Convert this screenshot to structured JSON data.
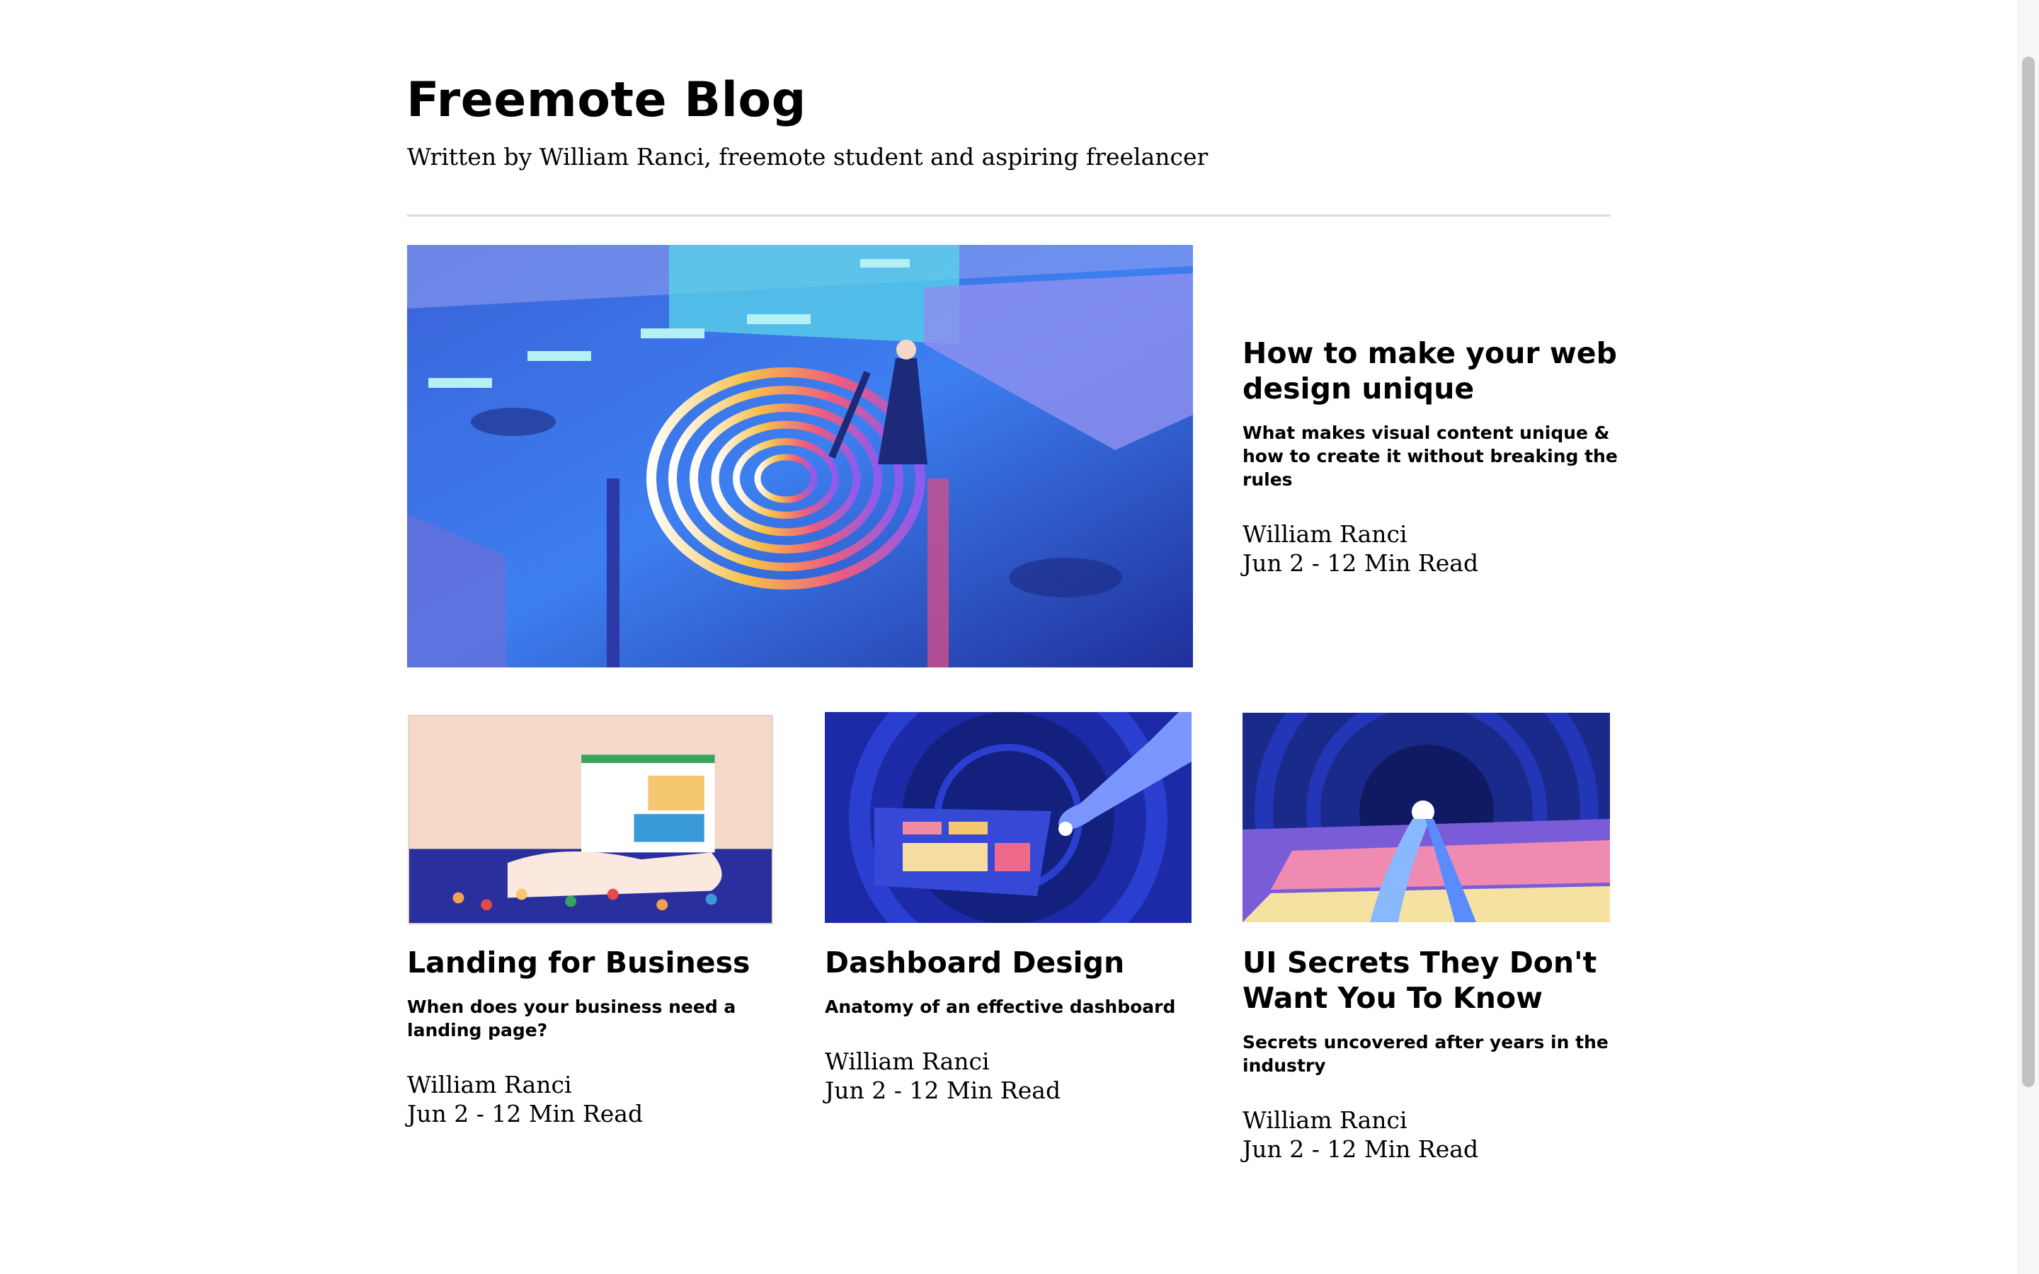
{
  "header": {
    "title": "Freemote Blog",
    "subtitle": "Written by William Ranci, freemote student and aspiring freelancer"
  },
  "featured": {
    "title_line1": "How to make your web",
    "title_line2": "design unique",
    "desc_line1": "What makes visual content unique &",
    "desc_line2": "how to create it without breaking the",
    "desc_line3": "rules",
    "author": "William Ranci",
    "meta": "Jun 2 - 12 Min Read"
  },
  "posts": [
    {
      "title_line1": "Landing for Business",
      "desc_line1": "When does your business need a",
      "desc_line2": "landing page?",
      "author": "William Ranci",
      "meta": "Jun 2 - 12 Min Read"
    },
    {
      "title_line1": "Dashboard Design",
      "desc_line1": "Anatomy of an effective dashboard",
      "author": "William Ranci",
      "meta": "Jun 2 - 12 Min Read"
    },
    {
      "title_line1": "UI Secrets They Don't",
      "title_line2": "Want You To Know",
      "desc_line1": "Secrets uncovered after years in the",
      "desc_line2": "industry",
      "author": "William Ranci",
      "meta": "Jun 2 - 12 Min Read"
    }
  ]
}
